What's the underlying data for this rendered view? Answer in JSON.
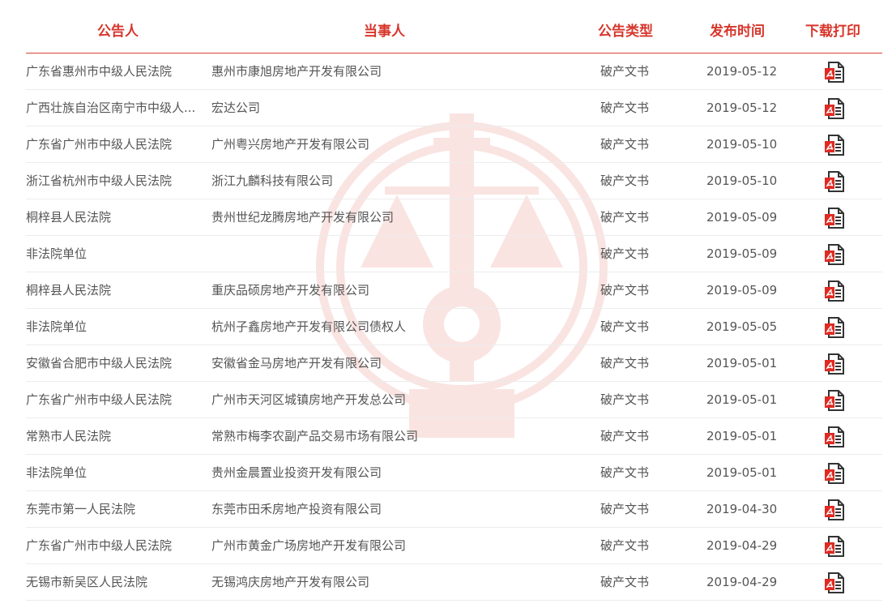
{
  "table": {
    "headers": {
      "court": "公告人",
      "party": "当事人",
      "type": "公告类型",
      "date": "发布时间",
      "download": "下载打印"
    },
    "rows": [
      {
        "court": "广东省惠州市中级人民法院",
        "party": "惠州市康旭房地产开发有限公司",
        "type": "破产文书",
        "date": "2019-05-12",
        "icon": "pdf-download-icon"
      },
      {
        "court": "广西壮族自治区南宁市中级人...",
        "party": "宏达公司",
        "type": "破产文书",
        "date": "2019-05-12",
        "icon": "pdf-download-icon"
      },
      {
        "court": "广东省广州市中级人民法院",
        "party": "广州粤兴房地产开发有限公司",
        "type": "破产文书",
        "date": "2019-05-10",
        "icon": "pdf-download-icon"
      },
      {
        "court": "浙江省杭州市中级人民法院",
        "party": "浙江九麟科技有限公司",
        "type": "破产文书",
        "date": "2019-05-10",
        "icon": "pdf-download-icon"
      },
      {
        "court": "桐梓县人民法院",
        "party": "贵州世纪龙腾房地产开发有限公司",
        "type": "破产文书",
        "date": "2019-05-09",
        "icon": "pdf-download-icon"
      },
      {
        "court": "非法院单位",
        "party": "",
        "type": "破产文书",
        "date": "2019-05-09",
        "icon": "pdf-download-icon"
      },
      {
        "court": "桐梓县人民法院",
        "party": "重庆品硕房地产开发有限公司",
        "type": "破产文书",
        "date": "2019-05-09",
        "icon": "pdf-download-icon"
      },
      {
        "court": "非法院单位",
        "party": "杭州子鑫房地产开发有限公司债权人",
        "type": "破产文书",
        "date": "2019-05-05",
        "icon": "pdf-download-icon"
      },
      {
        "court": "安徽省合肥市中级人民法院",
        "party": "安徽省金马房地产开发有限公司",
        "type": "破产文书",
        "date": "2019-05-01",
        "icon": "pdf-download-icon"
      },
      {
        "court": "广东省广州市中级人民法院",
        "party": "广州市天河区城镇房地产开发总公司",
        "type": "破产文书",
        "date": "2019-05-01",
        "icon": "pdf-download-icon"
      },
      {
        "court": "常熟市人民法院",
        "party": "常熟市梅李农副产品交易市场有限公司",
        "type": "破产文书",
        "date": "2019-05-01",
        "icon": "pdf-download-icon"
      },
      {
        "court": "非法院单位",
        "party": "贵州金晨置业投资开发有限公司",
        "type": "破产文书",
        "date": "2019-05-01",
        "icon": "pdf-download-icon"
      },
      {
        "court": "东莞市第一人民法院",
        "party": "东莞市田禾房地产投资有限公司",
        "type": "破产文书",
        "date": "2019-04-30",
        "icon": "pdf-download-icon"
      },
      {
        "court": "广东省广州市中级人民法院",
        "party": "广州市黄金广场房地产开发有限公司",
        "type": "破产文书",
        "date": "2019-04-29",
        "icon": "pdf-download-icon"
      },
      {
        "court": "无锡市新吴区人民法院",
        "party": "无锡鸿庆房地产开发有限公司",
        "type": "破产文书",
        "date": "2019-04-29",
        "icon": "pdf-download-icon"
      }
    ]
  },
  "colors": {
    "accent": "#d7362c",
    "text": "#555555",
    "row_border": "#ececec"
  },
  "watermark": {
    "icon": "court-emblem-icon"
  }
}
